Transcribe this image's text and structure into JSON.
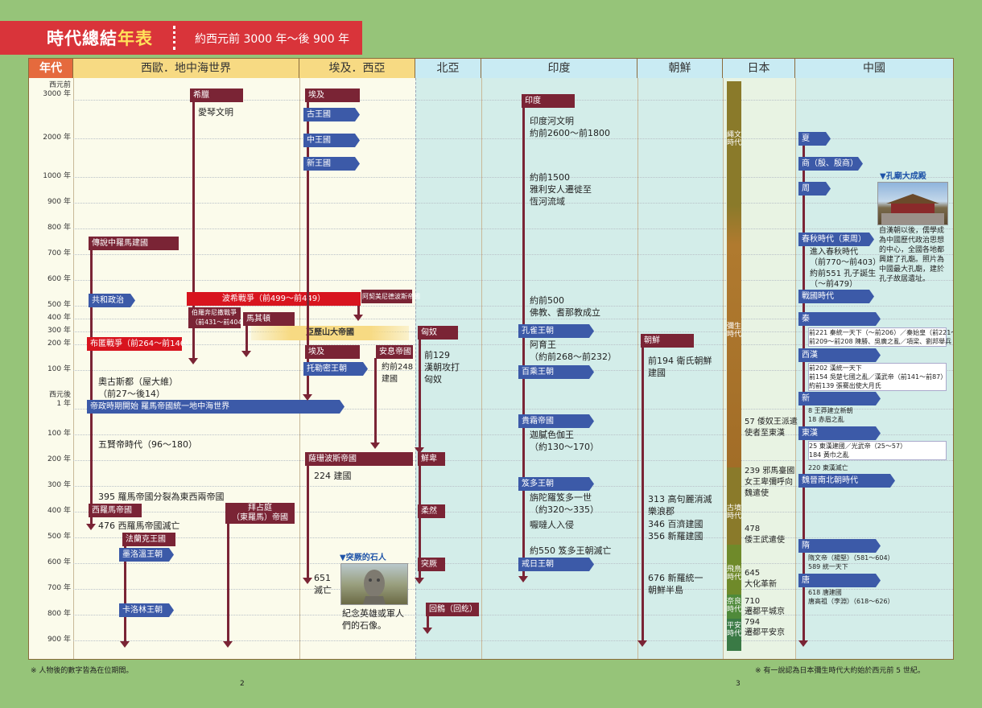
{
  "title": {
    "main": "時代總結",
    "highlight": "年表",
    "range": "約西元前 3000 年～後 900 年"
  },
  "headers": [
    "年代",
    "西歐．地中海世界",
    "埃及．西亞",
    "北亞",
    "印度",
    "朝鮮",
    "日本",
    "中國"
  ],
  "years": [
    {
      "label": "西元前",
      "label2": "3000 年"
    },
    {
      "label": "2000 年"
    },
    {
      "label": "1000 年"
    },
    {
      "label": "900 年"
    },
    {
      "label": "800 年"
    },
    {
      "label": "700 年"
    },
    {
      "label": "600 年"
    },
    {
      "label": "500 年"
    },
    {
      "label": "400 年"
    },
    {
      "label": "300 年"
    },
    {
      "label": "200 年"
    },
    {
      "label": "100 年"
    },
    {
      "label": "西元後",
      "label2": "1 年"
    },
    {
      "label": "100 年"
    },
    {
      "label": "200 年"
    },
    {
      "label": "300 年"
    },
    {
      "label": "400 年"
    },
    {
      "label": "500 年"
    },
    {
      "label": "600 年"
    },
    {
      "label": "700 年"
    },
    {
      "label": "800 年"
    },
    {
      "label": "900 年"
    }
  ],
  "west": {
    "greece": "希臘",
    "aegean": "愛琴文明",
    "rome_founding": "傳說中羅馬建國",
    "republic": "共和政治",
    "persian_war": "波希戰爭（前499～前449）",
    "achaemenid": "阿契美尼德波斯帝國",
    "peloponnesian": "伯羅奔尼撒戰爭",
    "peloponnesian_years": "（前431～前404）",
    "macedon": "馬其頓",
    "alexander": "亞歷山大帝國",
    "punic": "布匿戰爭（前264～前146）",
    "augustus": "奧古斯都（屋大維）",
    "augustus_years": "（前27～後14）",
    "empire": "帝政時期開始 羅馬帝國統一地中海世界",
    "five_emperors": "五賢帝時代（96～180）",
    "split": "395 羅馬帝國分裂為東西兩帝國",
    "western_rome": "西羅馬帝國",
    "western_fall": "476 西羅馬帝國滅亡",
    "byzantine": "拜占庭",
    "byzantine2": "（東羅馬）帝國",
    "frankish": "法蘭克王國",
    "merovingian": "墨洛溫王朝",
    "carolingian": "卡洛林王朝"
  },
  "egypt": {
    "egypt": "埃及",
    "old": "古王國",
    "middle": "中王國",
    "new": "新王國",
    "egypt2": "埃及",
    "ptolemaic": "托勒密王朝",
    "parthia": "安息帝國",
    "parthia_note": "約前248",
    "parthia_note2": "建國",
    "sassanid": "薩珊波斯帝國",
    "sassanid_note": "224 建國",
    "sassanid_fall": "651",
    "sassanid_fall2": "滅亡",
    "turk_stone_head": "▼突厥的石人",
    "turk_stone_caption": "紀念英雄或軍人",
    "turk_stone_caption2": "們的石像。"
  },
  "north": {
    "xiongnu": "匈奴",
    "xiongnu_note": "前129",
    "xiongnu_note2": "漢朝攻打",
    "xiongnu_note3": "匈奴",
    "xianbei": "鮮卑",
    "rouran": "柔然",
    "turk": "突厥",
    "uighur": "回鶻（回紇）"
  },
  "india": {
    "india": "印度",
    "indus": "印度河文明",
    "indus_years": "約前2600～前1800",
    "aryan": "約前1500",
    "aryan2": "雅利安人遷徙至",
    "aryan3": "恆河流域",
    "buddhism": "約前500",
    "buddhism2": "佛教、耆那教成立",
    "maurya": "孔雀王朝",
    "ashoka": "阿育王",
    "ashoka_years": "（約前268～前232）",
    "satavahana": "百乘王朝",
    "kushan": "貴霜帝國",
    "kanishka": "迦膩色伽王",
    "kanishka_years": "（約130～170）",
    "gupta": "笈多王朝",
    "chandragupta": "旃陀羅笈多一世",
    "chandragupta_years": "（約320～335）",
    "huna": "嚈噠人入侵",
    "gupta_fall": "約550 笈多王朝滅亡",
    "harsha": "戒日王朝"
  },
  "korea": {
    "joseon": "朝鮮",
    "wiman": "前194 衛氏朝鮮",
    "wiman2": "建國",
    "goguryeo": "313 高句麗消滅",
    "goguryeo2": "樂浪郡",
    "baekje": "346 百濟建國",
    "silla": "356 新羅建國",
    "unify": "676 新羅統一",
    "unify2": "朝鮮半島"
  },
  "japan": {
    "jomon": "繩文時代",
    "yayoi": "彌生時代",
    "kofun": "古墳時代",
    "asuka": "飛鳥時代",
    "nara": "奈良時代",
    "heian": "平安時代",
    "e57": "57 倭奴王派遣",
    "e57b": "使者至東漢",
    "e239": "239 邪馬臺國",
    "e239b": "女王卑彌呼向",
    "e239c": "魏遣使",
    "e478": "478",
    "e478b": "倭王武遣使",
    "e645": "645",
    "e645b": "大化革新",
    "e710": "710",
    "e710b": "遷都平城京",
    "e794": "794",
    "e794b": "遷都平安京"
  },
  "china": {
    "xia": "夏",
    "shang": "商（殷、殷商）",
    "zhou": "周",
    "confucius_head": "▼孔廟大成殿",
    "confucius_caption": "自漢朝以後，儒學成",
    "confucius_caption2": "為中國歷代政治思想",
    "confucius_caption3": "的中心，全國各地都",
    "confucius_caption4": "興建了孔廟。照片為",
    "confucius_caption5": "中國最大孔廟，建於",
    "confucius_caption6": "孔子故居遺址。",
    "spring": "春秋時代（東周）",
    "spring_note": "進入春秋時代",
    "spring_note2": "（前770～前403）",
    "confucius_born": "約前551 孔子誕生",
    "confucius_born2": "（～前479）",
    "warring": "戰國時代",
    "qin": "秦",
    "qin_note": "前221 秦統一天下（～前206）／秦始皇（前221～前210）",
    "qin_note2": "前209～前208 陳勝、吳廣之亂／項梁、劉邦舉兵",
    "western_han": "西漢",
    "han_note": "前202 漢統一天下",
    "han_note2": "前154 吳楚七國之亂／漢武帝（前141～前87）",
    "han_note3": "約前139 張騫出使大月氏",
    "xin": "新",
    "xin_note": "8 王莽建立新朝",
    "xin_note2": "18 赤眉之亂",
    "eastern_han": "東漢",
    "eh_note": "25 東漢建國／光武帝（25～57）",
    "eh_note2": "184 黃巾之亂",
    "eh_note3": "220 東漢滅亡",
    "wei_jin": "魏晉南北朝時代",
    "sui": "隋",
    "sui_note": "隋文帝（楊堅）（581～604）",
    "sui_note2": "589 統一天下",
    "tang": "唐",
    "tang_note": "618 唐建國",
    "tang_note2": "唐高祖（李淵）（618～626）"
  },
  "footnotes": {
    "left": "※ 人物後的數字皆為在位期間。",
    "right": "※ 有一說認為日本彌生時代大約始於西元前 5 世紀。",
    "page_left": "2",
    "page_right": "3"
  },
  "colors": {
    "maroon": "#7a2435",
    "blue": "#3c5aa8",
    "red": "#d8141e",
    "banner": "#d9343a",
    "header_year": "#e56a3d",
    "header_warm": "#f7da83",
    "header_cool": "#c9ebf3"
  }
}
